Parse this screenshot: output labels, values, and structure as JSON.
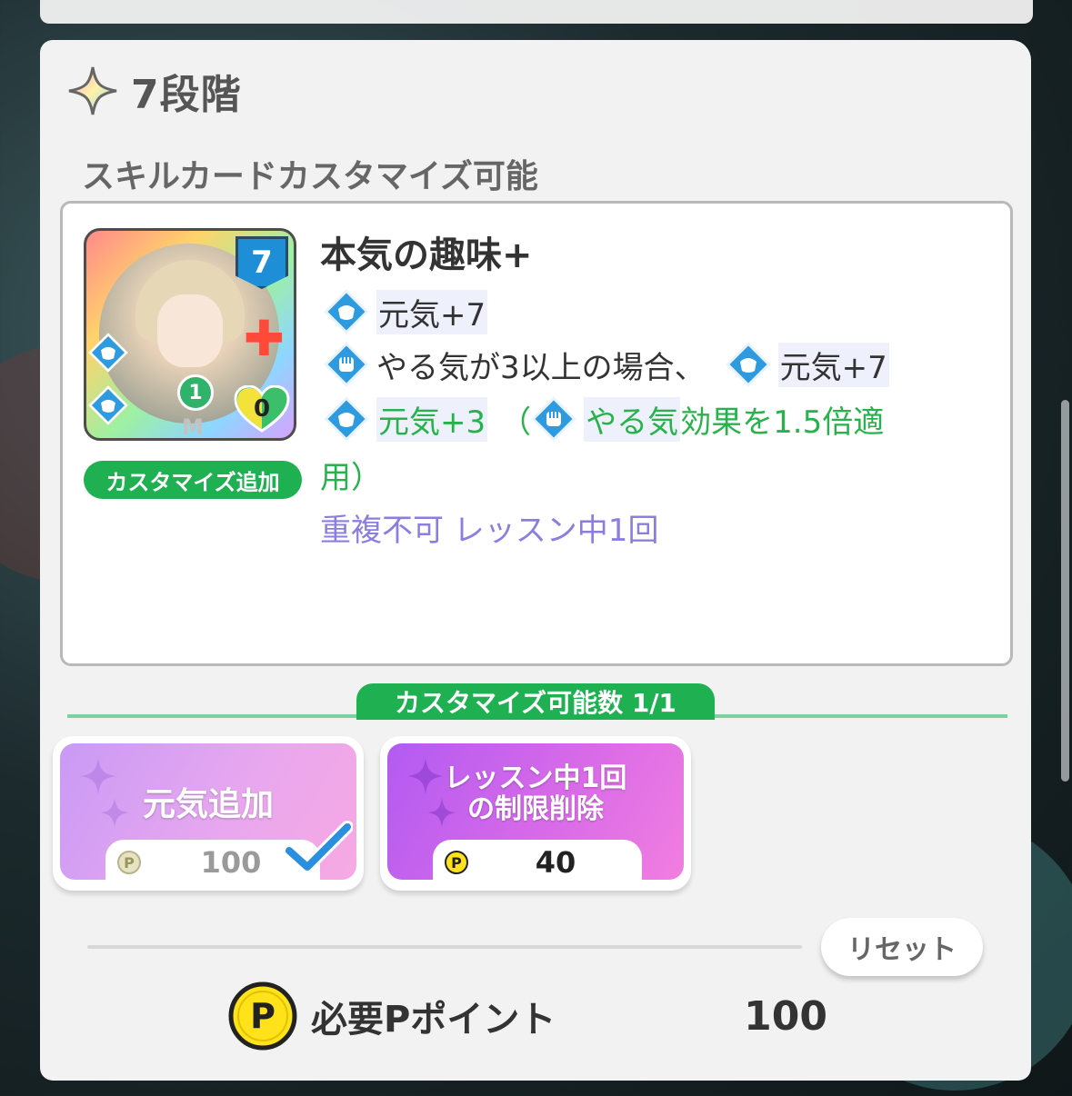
{
  "stage": {
    "title": "7段階",
    "icon": "sparkle-icon"
  },
  "subtitle": "スキルカードカスタマイズ可能",
  "card": {
    "cost": "7",
    "level": "1",
    "heart_count": "0",
    "rarity_mark": "M",
    "customize_badge": "カスタマイズ追加",
    "name": "本気の趣味+",
    "effects": {
      "line1": {
        "text": "元気+7"
      },
      "line2": {
        "pre": "やる気が3以上の場合、",
        "post": "元気+7"
      },
      "line3": {
        "a": "元気+3",
        "b": "（",
        "c": "やる気",
        "d": "効果を1.5倍適"
      },
      "line4": "用）",
      "line5": "重複不可 レッスン中1回"
    }
  },
  "customize_limit": "カスタマイズ可能数 1/1",
  "options": [
    {
      "label": "元気追加",
      "price": "100",
      "selected": true
    },
    {
      "label_line1": "レッスン中1回",
      "label_line2": "の制限削除",
      "price": "40",
      "selected": false
    }
  ],
  "reset_label": "リセット",
  "total": {
    "label": "必要Pポイント",
    "value": "100"
  },
  "colors": {
    "green": "#1fb052",
    "purple": "#8a7fe0",
    "accent_blue": "#1e8fd6",
    "coin": "#ffe21a"
  }
}
